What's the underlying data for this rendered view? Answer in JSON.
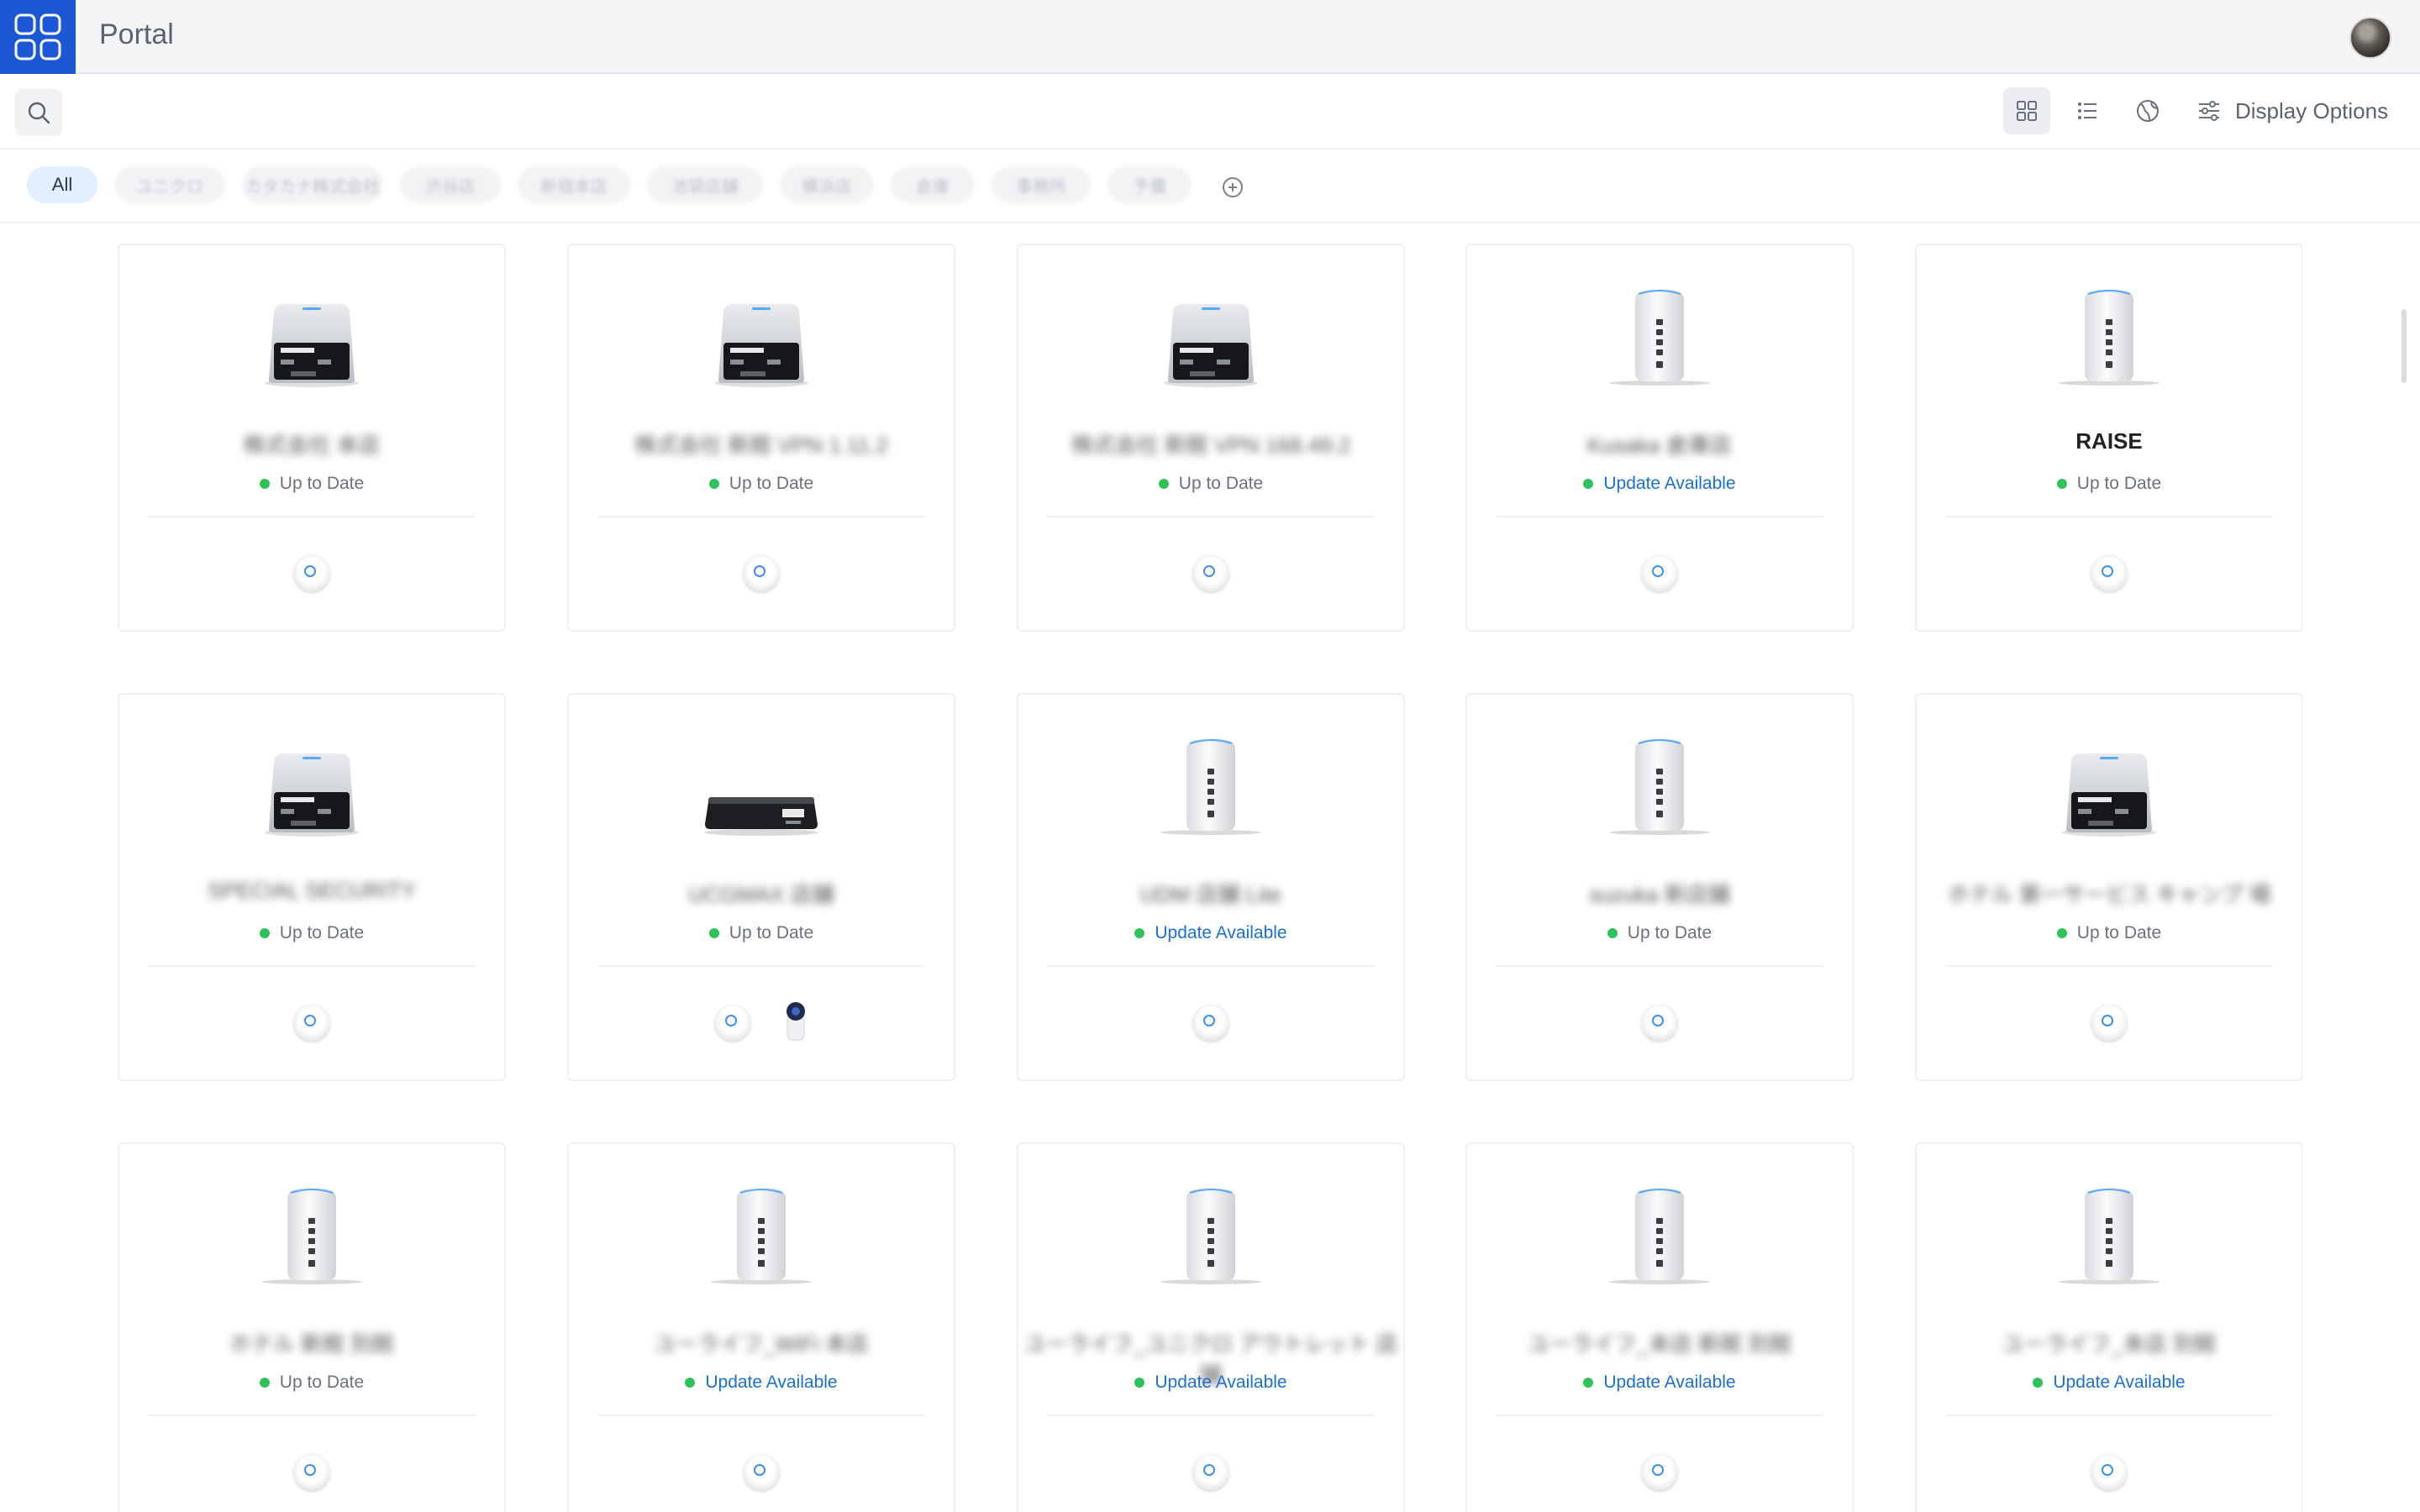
{
  "header": {
    "title": "Portal"
  },
  "toolbar": {
    "display_options_label": "Display Options"
  },
  "filters": {
    "chips": [
      "All",
      "ユニクロ",
      "カタカナ株式会社",
      "渋谷店",
      "新宿本店",
      "池袋店舗",
      "横浜店",
      "倉庫",
      "事務所",
      "予備"
    ],
    "active": "All"
  },
  "sites": [
    {
      "name": "株式会社 本店",
      "status": "Up to Date",
      "device": "console",
      "clients": [
        "ap"
      ],
      "blurred": true
    },
    {
      "name": "株式会社 新館 VPN 1.11.2",
      "status": "Up to Date",
      "device": "console",
      "clients": [
        "ap"
      ],
      "blurred": true
    },
    {
      "name": "株式会社 新館 VPN 168.49.2",
      "status": "Up to Date",
      "device": "console",
      "clients": [
        "ap"
      ],
      "blurred": true
    },
    {
      "name": "Kusaka 倉庫店",
      "status": "Update Available",
      "device": "tower",
      "clients": [
        "ap"
      ],
      "blurred": true
    },
    {
      "name": "RAISE",
      "status": "Up to Date",
      "device": "tower",
      "clients": [
        "ap"
      ],
      "blurred": false
    },
    {
      "name": "SPECIAL SECURITY",
      "status": "Up to Date",
      "device": "console",
      "clients": [
        "ap"
      ],
      "blurred": true
    },
    {
      "name": "UCGMAX 店舗",
      "status": "Up to Date",
      "device": "flat",
      "clients": [
        "ap",
        "camera"
      ],
      "blurred": true
    },
    {
      "name": "UDM 店舗 Lite",
      "status": "Update Available",
      "device": "tower",
      "clients": [
        "ap"
      ],
      "blurred": true
    },
    {
      "name": "suzuka 新店舗",
      "status": "Up to Date",
      "device": "tower",
      "clients": [
        "ap"
      ],
      "blurred": true
    },
    {
      "name": "ホテル 第一サービス キャンプ 場",
      "status": "Up to Date",
      "device": "console",
      "clients": [
        "ap"
      ],
      "blurred": true
    },
    {
      "name": "ホテル 新館 別館",
      "status": "Up to Date",
      "device": "tower",
      "clients": [
        "ap"
      ],
      "blurred": true
    },
    {
      "name": "ユーライフ_WiFi 本店",
      "status": "Update Available",
      "device": "tower",
      "clients": [
        "ap"
      ],
      "blurred": true
    },
    {
      "name": "ユーライフ_ユニクロ アウトレット 店舗",
      "status": "Update Available",
      "device": "tower",
      "clients": [
        "ap"
      ],
      "blurred": true
    },
    {
      "name": "ユーライフ_本店 新館 別館",
      "status": "Update Available",
      "device": "tower",
      "clients": [
        "ap"
      ],
      "blurred": true
    },
    {
      "name": "ユーライフ_本店 別館",
      "status": "Update Available",
      "device": "tower",
      "clients": [
        "ap"
      ],
      "blurred": true
    }
  ],
  "colors": {
    "accent": "#1a58d6",
    "status_ok": "#2fc25b",
    "update_link": "#1a6fd8"
  }
}
